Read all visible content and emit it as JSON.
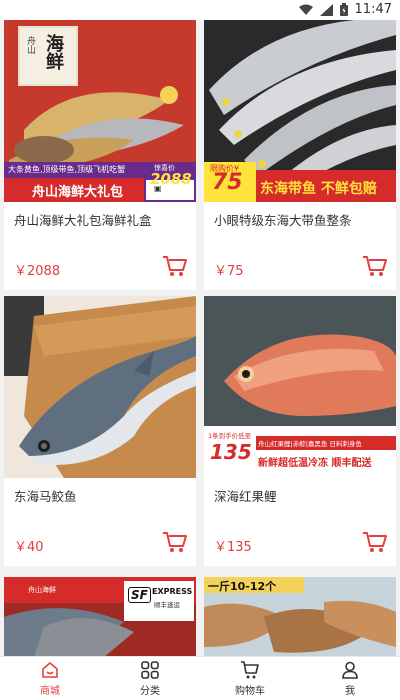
{
  "status": {
    "time": "11:47"
  },
  "products": [
    {
      "title": "舟山海鲜大礼包海鲜礼盒",
      "price": "￥2088",
      "banner": {
        "main": "舟山海鲜大礼包",
        "sub": "大条黄鱼,顶级带鱼,顶级飞机吃蟹",
        "tag": "惊喜价",
        "price": "2088",
        "logo": "海鲜",
        "brand": "舟山"
      }
    },
    {
      "title": "小眼特级东海大带鱼整条",
      "price": "￥75",
      "banner": {
        "tag": "限购价¥",
        "price": "75",
        "main": "东海带鱼 不鲜包赔"
      }
    },
    {
      "title": "东海马鲛鱼",
      "price": "￥40",
      "banner": {}
    },
    {
      "title": "深海红果鲤",
      "price": "￥135",
      "banner": {
        "tag": "1条到手价低至",
        "price": "135",
        "sub": "舟山红果鲤|赤鯮|嘉黑鱼 日料刺身鱼",
        "main": "新鲜超低温冷冻 顺丰配送"
      }
    },
    {
      "title": "",
      "price": "",
      "banner": {
        "brand": "舟山海鲜",
        "badge": "SF",
        "express": "EXPRESS",
        "express_sub": "顺丰速运"
      }
    },
    {
      "title": "",
      "price": "",
      "banner": {
        "main": "一斤10-12个"
      }
    }
  ],
  "tabs": [
    {
      "label": "商城",
      "icon": "home-icon"
    },
    {
      "label": "分类",
      "icon": "grid-icon"
    },
    {
      "label": "购物车",
      "icon": "cart-icon"
    },
    {
      "label": "我",
      "icon": "person-icon"
    }
  ],
  "colors": {
    "accent": "#e24040",
    "banner_red": "#d62b2b",
    "banner_yellow": "#ffe23a"
  }
}
